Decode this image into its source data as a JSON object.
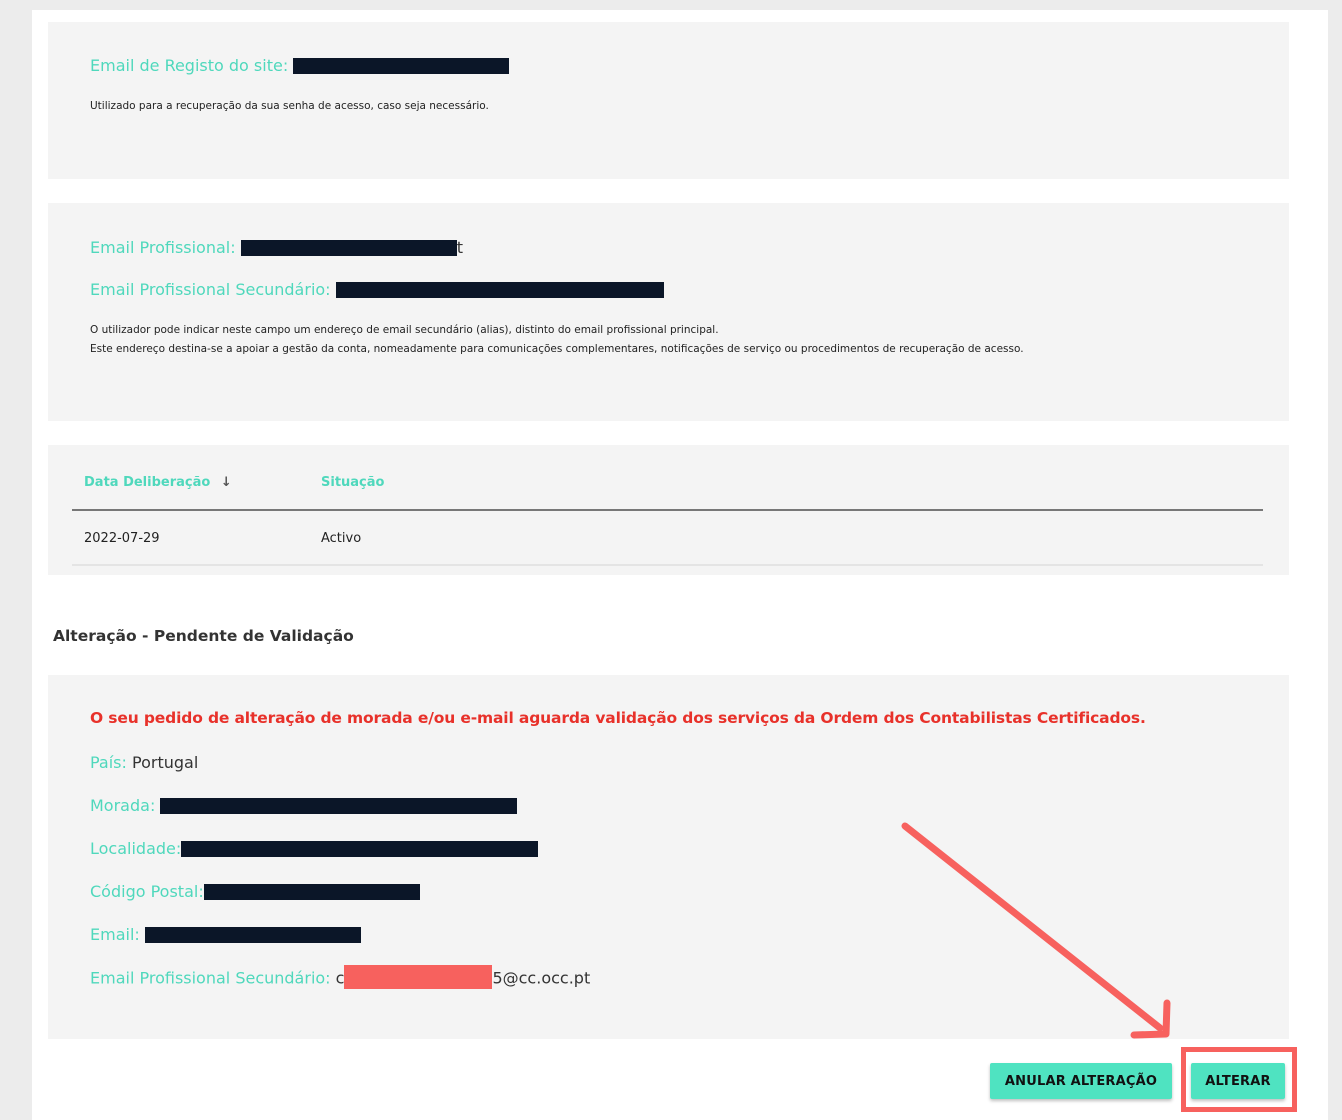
{
  "registo": {
    "label": "Email de Registo do site:",
    "note": "Utilizado para a recuperação da sua senha de acesso, caso seja necessário."
  },
  "profissional": {
    "email_label": "Email Profissional:",
    "email_suffix": "t",
    "secundario_label": "Email Profissional Secundário:",
    "note_line1": "O utilizador pode indicar neste campo um endereço de email secundário (alias), distinto do email profissional principal.",
    "note_line2": "Este endereço destina-se a apoiar a gestão da conta, nomeadamente para comunicações complementares, notificações de serviço ou procedimentos de recuperação de acesso."
  },
  "table": {
    "headers": [
      "Data Deliberação",
      "Situação"
    ],
    "sort_arrow": "↓",
    "rows": [
      {
        "data": "2022-07-29",
        "situacao": "Activo"
      }
    ]
  },
  "pendente": {
    "section_title": "Alteração - Pendente de Validação",
    "warning": "O seu pedido de alteração de morada e/ou e-mail aguarda validação dos serviços da Ordem dos Contabilistas Certificados.",
    "pais_label": "País:",
    "pais_value": "Portugal",
    "morada_label": "Morada:",
    "localidade_label": "Localidade:",
    "codigo_postal_label": "Código Postal:",
    "email_label": "Email:",
    "secundario_label": "Email Profissional Secundário:",
    "secundario_prefix": "c",
    "secundario_suffix": "5@cc.occ.pt"
  },
  "actions": {
    "anular_label": "ANULAR ALTERAÇÃO",
    "alterar_label": "ALTERAR"
  },
  "colors": {
    "accent": "#4fd8bc",
    "button": "#4fe3c1",
    "warning": "#e8312a",
    "annotation": "#f7615e",
    "redaction": "#0b1628"
  }
}
